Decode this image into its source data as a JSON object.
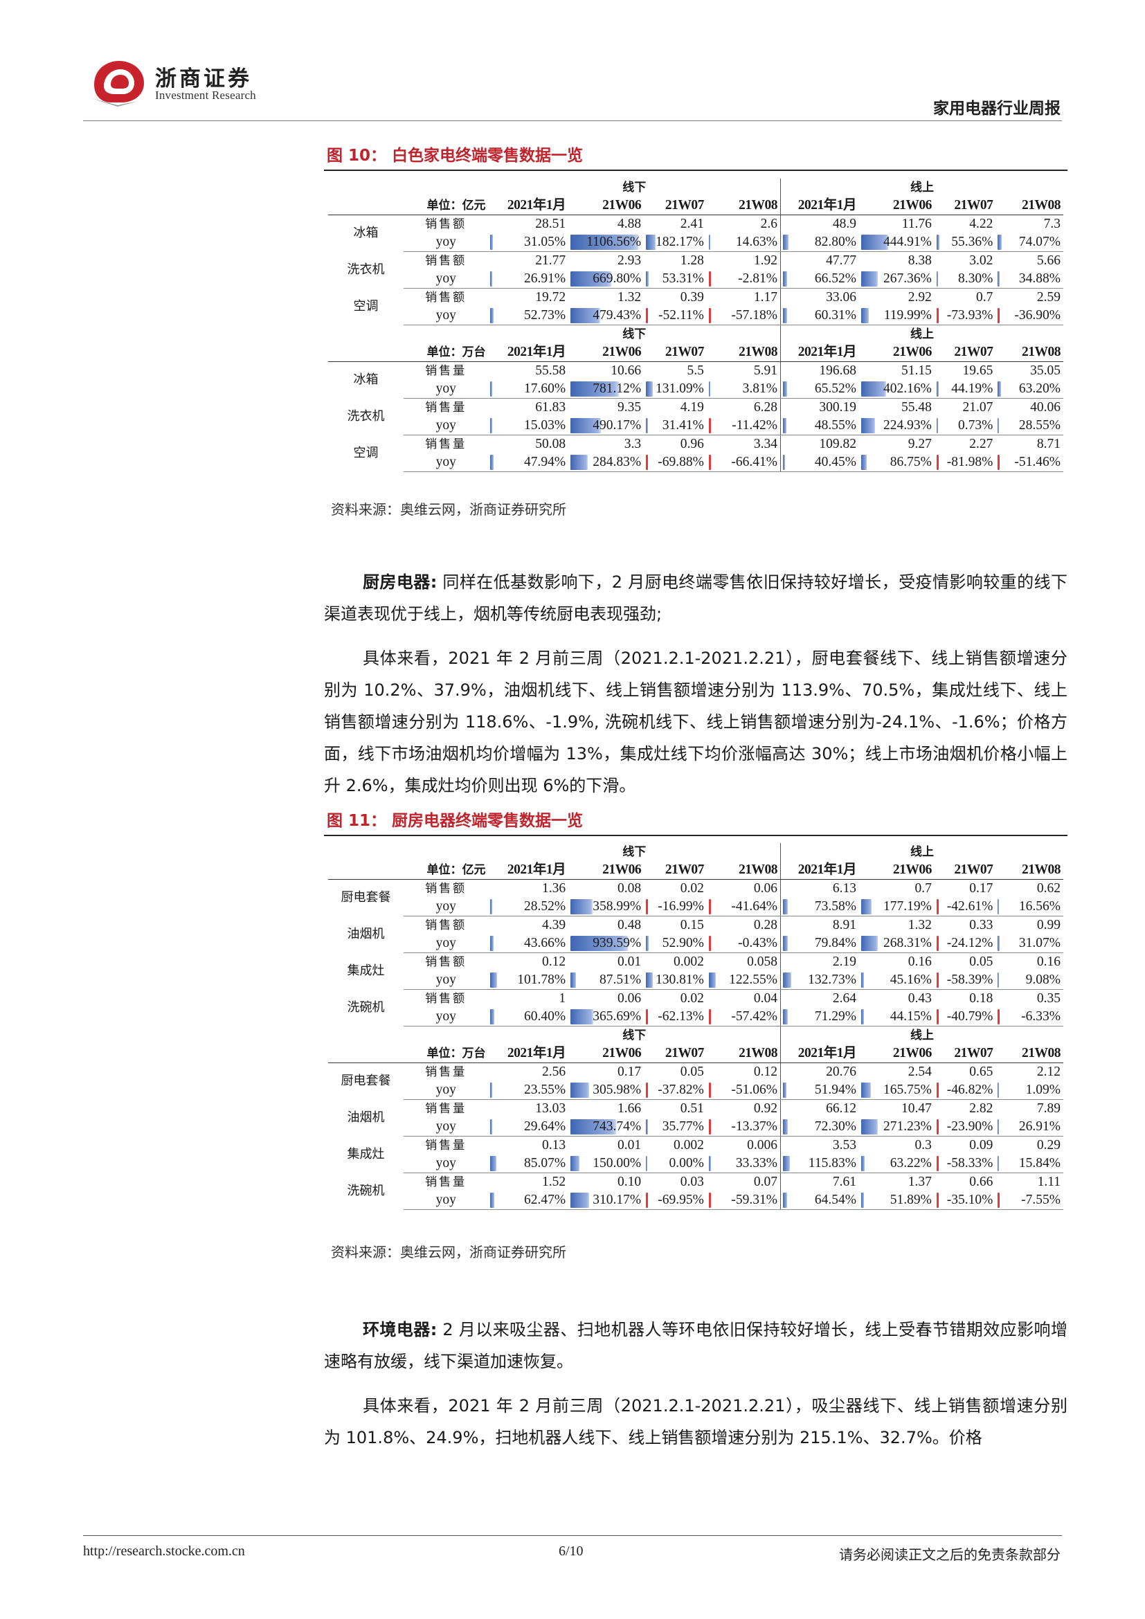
{
  "header": {
    "logo_cn": "浙商证券",
    "logo_en": "Investment Research",
    "doc_title": "家用电器行业周报"
  },
  "colors": {
    "accent_red": "#c0232c",
    "bar_blue": "#3f66b3",
    "bar_red": "#e23a3a"
  },
  "figure10": {
    "caption": "图 10： 白色家电终端零售数据一览",
    "source": "资料来源：奥维云网，浙商证券研究所",
    "sections": [
      {
        "unit": "单位：亿元",
        "group_offline": "线下",
        "group_online": "线上",
        "periods": [
          "2021年1月",
          "21W06",
          "21W07",
          "21W08"
        ],
        "rows": [
          {
            "category": "冰箱",
            "metric": "销售额",
            "yoy": "yoy",
            "offline": [
              "28.51",
              "4.88",
              "2.41",
              "2.6"
            ],
            "offline_yoy": [
              "31.05%",
              "1106.56%",
              "182.17%",
              "14.63%"
            ],
            "online": [
              "48.9",
              "11.76",
              "4.22",
              "7.3"
            ],
            "online_yoy": [
              "82.80%",
              "444.91%",
              "55.36%",
              "74.07%"
            ]
          },
          {
            "category": "洗衣机",
            "metric": "销售额",
            "yoy": "yoy",
            "offline": [
              "21.77",
              "2.93",
              "1.28",
              "1.92"
            ],
            "offline_yoy": [
              "26.91%",
              "669.80%",
              "53.31%",
              "-2.81%"
            ],
            "online": [
              "47.77",
              "8.38",
              "3.02",
              "5.66"
            ],
            "online_yoy": [
              "66.52%",
              "267.36%",
              "8.30%",
              "34.88%"
            ]
          },
          {
            "category": "空调",
            "metric": "销售额",
            "yoy": "yoy",
            "offline": [
              "19.72",
              "1.32",
              "0.39",
              "1.17"
            ],
            "offline_yoy": [
              "52.73%",
              "479.43%",
              "-52.11%",
              "-57.18%"
            ],
            "online": [
              "33.06",
              "2.92",
              "0.7",
              "2.59"
            ],
            "online_yoy": [
              "60.31%",
              "119.99%",
              "-73.93%",
              "-36.90%"
            ]
          }
        ]
      },
      {
        "unit": "单位：万台",
        "group_offline": "线下",
        "group_online": "线上",
        "periods": [
          "2021年1月",
          "21W06",
          "21W07",
          "21W08"
        ],
        "rows": [
          {
            "category": "冰箱",
            "metric": "销售量",
            "yoy": "yoy",
            "offline": [
              "55.58",
              "10.66",
              "5.5",
              "5.91"
            ],
            "offline_yoy": [
              "17.60%",
              "781.12%",
              "131.09%",
              "3.81%"
            ],
            "online": [
              "196.68",
              "51.15",
              "19.65",
              "35.05"
            ],
            "online_yoy": [
              "65.52%",
              "402.16%",
              "44.19%",
              "63.20%"
            ]
          },
          {
            "category": "洗衣机",
            "metric": "销售量",
            "yoy": "yoy",
            "offline": [
              "61.83",
              "9.35",
              "4.19",
              "6.28"
            ],
            "offline_yoy": [
              "15.03%",
              "490.17%",
              "31.41%",
              "-11.42%"
            ],
            "online": [
              "300.19",
              "55.48",
              "21.07",
              "40.06"
            ],
            "online_yoy": [
              "48.55%",
              "224.93%",
              "0.73%",
              "28.55%"
            ]
          },
          {
            "category": "空调",
            "metric": "销售量",
            "yoy": "yoy",
            "offline": [
              "50.08",
              "3.3",
              "0.96",
              "3.34"
            ],
            "offline_yoy": [
              "47.94%",
              "284.83%",
              "-69.88%",
              "-66.41%"
            ],
            "online": [
              "109.82",
              "9.27",
              "2.27",
              "8.71"
            ],
            "online_yoy": [
              "40.45%",
              "86.75%",
              "-81.98%",
              "-51.46%"
            ]
          }
        ]
      }
    ]
  },
  "kitchen": {
    "lead": "厨房电器:",
    "para1": "同样在低基数影响下，2 月厨电终端零售依旧保持较好增长，受疫情影响较重的线下渠道表现优于线上，烟机等传统厨电表现强劲;",
    "para2": "具体来看，2021 年 2 月前三周（2021.2.1-2021.2.21），厨电套餐线下、线上销售额增速分别为 10.2%、37.9%，油烟机线下、线上销售额增速分别为 113.9%、70.5%，集成灶线下、线上销售额增速分别为 118.6%、-1.9%, 洗碗机线下、线上销售额增速分别为-24.1%、-1.6%；价格方面，线下市场油烟机均价增幅为 13%，集成灶线下均价涨幅高达 30%；线上市场油烟机价格小幅上升 2.6%，集成灶均价则出现 6%的下滑。"
  },
  "figure11": {
    "caption": "图 11： 厨房电器终端零售数据一览",
    "source": "资料来源：奥维云网，浙商证券研究所",
    "sections": [
      {
        "unit": "单位：亿元",
        "group_offline": "线下",
        "group_online": "线上",
        "periods": [
          "2021年1月",
          "21W06",
          "21W07",
          "21W08"
        ],
        "rows": [
          {
            "category": "厨电套餐",
            "metric": "销售额",
            "yoy": "yoy",
            "offline": [
              "1.36",
              "0.08",
              "0.02",
              "0.06"
            ],
            "offline_yoy": [
              "28.52%",
              "358.99%",
              "-16.99%",
              "-41.64%"
            ],
            "online": [
              "6.13",
              "0.7",
              "0.17",
              "0.62"
            ],
            "online_yoy": [
              "73.58%",
              "177.19%",
              "-42.61%",
              "16.56%"
            ]
          },
          {
            "category": "油烟机",
            "metric": "销售额",
            "yoy": "yoy",
            "offline": [
              "4.39",
              "0.48",
              "0.15",
              "0.28"
            ],
            "offline_yoy": [
              "43.66%",
              "939.59%",
              "52.90%",
              "-0.43%"
            ],
            "online": [
              "8.91",
              "1.32",
              "0.33",
              "0.99"
            ],
            "online_yoy": [
              "79.84%",
              "268.31%",
              "-24.12%",
              "31.07%"
            ]
          },
          {
            "category": "集成灶",
            "metric": "销售额",
            "yoy": "yoy",
            "offline": [
              "0.12",
              "0.01",
              "0.002",
              "0.058"
            ],
            "offline_yoy": [
              "101.78%",
              "87.51%",
              "130.81%",
              "122.55%"
            ],
            "online": [
              "2.19",
              "0.16",
              "0.05",
              "0.16"
            ],
            "online_yoy": [
              "132.73%",
              "45.16%",
              "-58.39%",
              "9.08%"
            ]
          },
          {
            "category": "洗碗机",
            "metric": "销售额",
            "yoy": "yoy",
            "offline": [
              "1",
              "0.06",
              "0.02",
              "0.04"
            ],
            "offline_yoy": [
              "60.40%",
              "365.69%",
              "-62.13%",
              "-57.42%"
            ],
            "online": [
              "2.64",
              "0.43",
              "0.18",
              "0.35"
            ],
            "online_yoy": [
              "71.29%",
              "44.15%",
              "-40.79%",
              "-6.33%"
            ]
          }
        ]
      },
      {
        "unit": "单位：万台",
        "group_offline": "线下",
        "group_online": "线上",
        "periods": [
          "2021年1月",
          "21W06",
          "21W07",
          "21W08"
        ],
        "rows": [
          {
            "category": "厨电套餐",
            "metric": "销售量",
            "yoy": "yoy",
            "offline": [
              "2.56",
              "0.17",
              "0.05",
              "0.12"
            ],
            "offline_yoy": [
              "23.55%",
              "305.98%",
              "-37.82%",
              "-51.06%"
            ],
            "online": [
              "20.76",
              "2.54",
              "0.65",
              "2.12"
            ],
            "online_yoy": [
              "51.94%",
              "165.75%",
              "-46.82%",
              "1.09%"
            ]
          },
          {
            "category": "油烟机",
            "metric": "销售量",
            "yoy": "yoy",
            "offline": [
              "13.03",
              "1.66",
              "0.51",
              "0.92"
            ],
            "offline_yoy": [
              "29.64%",
              "743.74%",
              "35.77%",
              "-13.37%"
            ],
            "online": [
              "66.12",
              "10.47",
              "2.82",
              "7.89"
            ],
            "online_yoy": [
              "72.30%",
              "271.23%",
              "-23.90%",
              "26.91%"
            ]
          },
          {
            "category": "集成灶",
            "metric": "销售量",
            "yoy": "yoy",
            "offline": [
              "0.13",
              "0.01",
              "0.002",
              "0.006"
            ],
            "offline_yoy": [
              "85.07%",
              "150.00%",
              "0.00%",
              "33.33%"
            ],
            "online": [
              "3.53",
              "0.3",
              "0.09",
              "0.29"
            ],
            "online_yoy": [
              "115.83%",
              "63.22%",
              "-58.33%",
              "15.84%"
            ]
          },
          {
            "category": "洗碗机",
            "metric": "销售量",
            "yoy": "yoy",
            "offline": [
              "1.52",
              "0.10",
              "0.03",
              "0.07"
            ],
            "offline_yoy": [
              "62.47%",
              "310.17%",
              "-69.95%",
              "-59.31%"
            ],
            "online": [
              "7.61",
              "1.37",
              "0.66",
              "1.11"
            ],
            "online_yoy": [
              "64.54%",
              "51.89%",
              "-35.10%",
              "-7.55%"
            ]
          }
        ]
      }
    ]
  },
  "environment": {
    "lead": "环境电器:",
    "para1": "2 月以来吸尘器、扫地机器人等环电依旧保持较好增长，线上受春节错期效应影响增速略有放缓，线下渠道加速恢复。",
    "para2": "具体来看，2021 年 2 月前三周（2021.2.1-2021.2.21），吸尘器线下、线上销售额增速分别为 101.8%、24.9%，扫地机器人线下、线上销售额增速分别为 215.1%、32.7%。价格"
  },
  "footer": {
    "url": "http://research.stocke.com.cn",
    "page": "6/10",
    "note": "请务必阅读正文之后的免责条款部分"
  }
}
